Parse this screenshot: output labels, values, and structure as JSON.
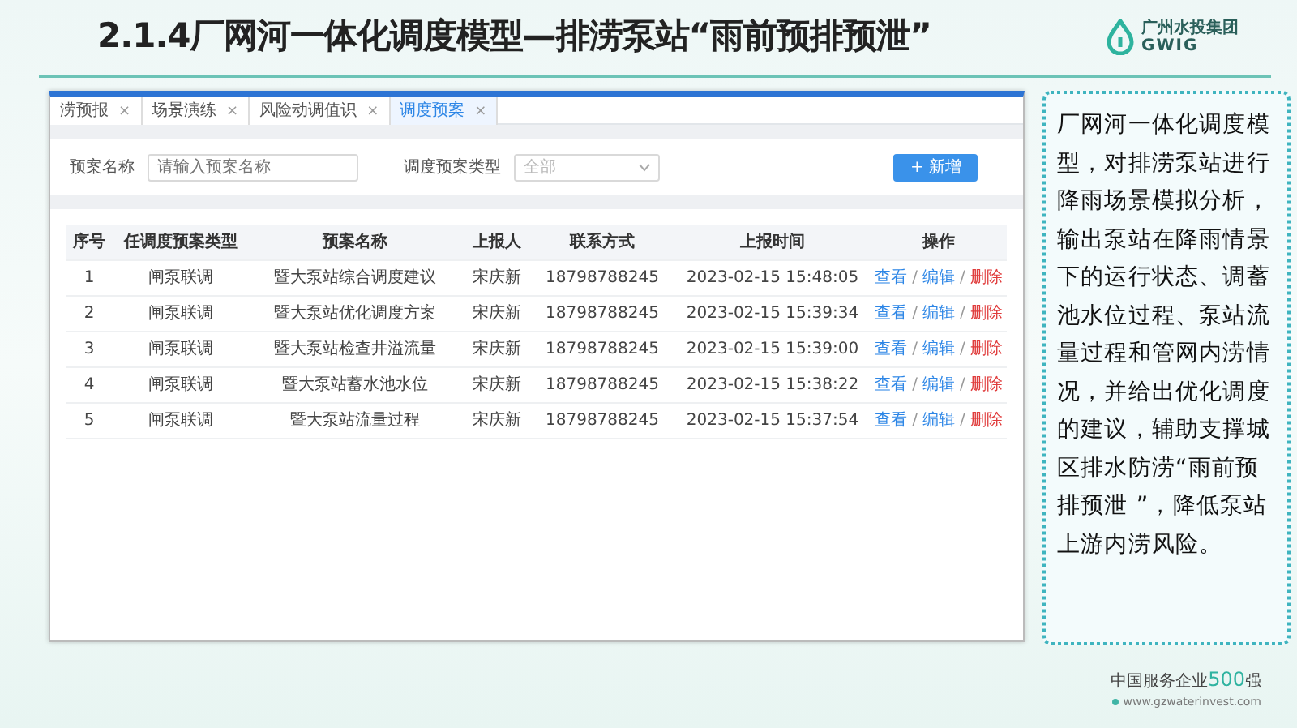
{
  "slide": {
    "title": "2.1.4厂网河一体化调度模型—排涝泵站“雨前预排预泄”",
    "logo": {
      "name": "广州水投集团",
      "abbr": "GWIG"
    }
  },
  "app": {
    "tabs": [
      {
        "label": "涝预报",
        "selected": false
      },
      {
        "label": "场景演练",
        "selected": false
      },
      {
        "label": "风险动调值识",
        "selected": false
      },
      {
        "label": "调度预案",
        "selected": true
      }
    ],
    "close_glyph": "×",
    "filters": [
      {
        "kind": "input",
        "label": "预案名称",
        "placeholder": "请输入预案名称"
      },
      {
        "kind": "select",
        "label": "调度预案类型",
        "placeholder": "全部"
      }
    ],
    "add_button": "+ 新增",
    "table": {
      "columns": [
        "序号",
        "任调度预案类型",
        "预案名称",
        "上报人",
        "联系方式",
        "上报时间",
        "操作"
      ],
      "separator": "/",
      "rows": [
        {
          "cells": [
            "1",
            "闸泵联调",
            "暨大泵站综合调度建议",
            "宋庆新",
            "18798788245",
            "2023-02-15 15:48:05"
          ],
          "actions": [
            {
              "kind": "view",
              "label": "查看"
            },
            {
              "kind": "edit",
              "label": "编辑"
            },
            {
              "kind": "delete",
              "label": "删除"
            }
          ]
        },
        {
          "cells": [
            "2",
            "闸泵联调",
            "暨大泵站优化调度方案",
            "宋庆新",
            "18798788245",
            "2023-02-15 15:39:34"
          ],
          "actions": [
            {
              "kind": "view",
              "label": "查看"
            },
            {
              "kind": "edit",
              "label": "编辑"
            },
            {
              "kind": "delete",
              "label": "删除"
            }
          ]
        },
        {
          "cells": [
            "3",
            "闸泵联调",
            "暨大泵站检查井溢流量",
            "宋庆新",
            "18798788245",
            "2023-02-15 15:39:00"
          ],
          "actions": [
            {
              "kind": "view",
              "label": "查看"
            },
            {
              "kind": "edit",
              "label": "编辑"
            },
            {
              "kind": "delete",
              "label": "删除"
            }
          ]
        },
        {
          "cells": [
            "4",
            "闸泵联调",
            "暨大泵站蓄水池水位",
            "宋庆新",
            "18798788245",
            "2023-02-15 15:38:22"
          ],
          "actions": [
            {
              "kind": "view",
              "label": "查看"
            },
            {
              "kind": "edit",
              "label": "编辑"
            },
            {
              "kind": "delete",
              "label": "删除"
            }
          ]
        },
        {
          "cells": [
            "5",
            "闸泵联调",
            "暨大泵站流量过程",
            "宋庆新",
            "18798788245",
            "2023-02-15 15:37:54"
          ],
          "actions": [
            {
              "kind": "view",
              "label": "查看"
            },
            {
              "kind": "edit",
              "label": "编辑"
            },
            {
              "kind": "delete",
              "label": "删除"
            }
          ]
        }
      ]
    }
  },
  "description": "厂网河一体化调度模型，对排涝泵站进行降雨场景模拟分析，输出泵站在降雨情景下的运行状态、调蓄池水位过程、泵站流量过程和管网内涝情况，并给出优化调度的建议，辅助支撑城区排水防涝“雨前预排预泄 ”，降低泵站上游内涝风险。",
  "footer": {
    "prefix": "中国服务企业",
    "highlight": "500",
    "suffix": "强",
    "website": "www.gzwaterinvest.com"
  }
}
